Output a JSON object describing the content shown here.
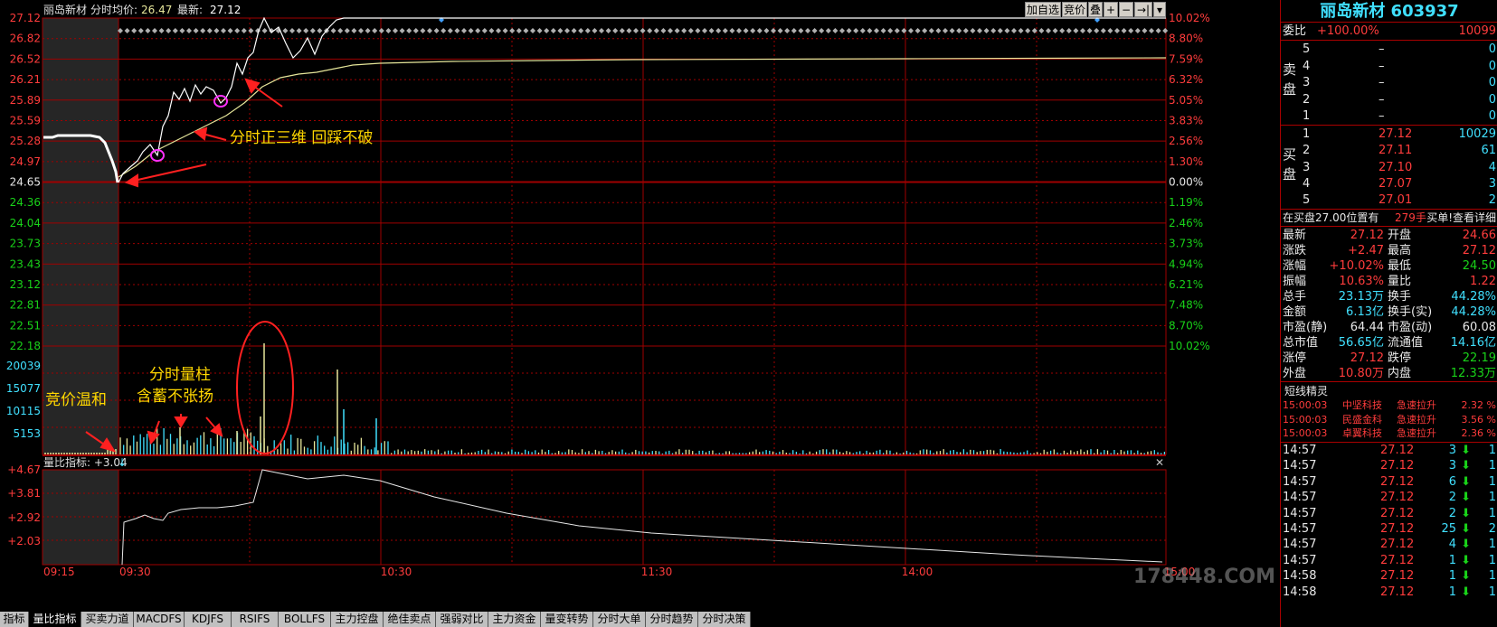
{
  "header": {
    "stock_name": "丽岛新材",
    "mode": "分时",
    "avg_label": "均价:",
    "avg_value": "26.47",
    "latest_label": "最新:",
    "latest_value": "27.12"
  },
  "toolbar": {
    "add_watch": "加自选",
    "auction": "竞价",
    "overlay": "叠",
    "zoom_in": "+",
    "zoom_out": "−",
    "next": "→|",
    "menu": "▾"
  },
  "price_axis_left": [
    "27.12",
    "26.82",
    "26.52",
    "26.21",
    "25.89",
    "25.59",
    "25.28",
    "24.97",
    "24.65",
    "24.36",
    "24.04",
    "23.73",
    "23.43",
    "23.12",
    "22.81",
    "22.51",
    "22.18"
  ],
  "pct_axis_right": [
    "10.02%",
    "8.80%",
    "7.59%",
    "6.32%",
    "5.05%",
    "3.83%",
    "2.56%",
    "1.30%",
    "0.00%",
    "1.19%",
    "2.46%",
    "3.73%",
    "4.94%",
    "6.21%",
    "7.48%",
    "8.70%",
    "10.02%"
  ],
  "volume_axis": [
    "20039",
    "15077",
    "10115",
    "5153"
  ],
  "indicator": {
    "label": "量比指标: +3.04",
    "arrow": "↓",
    "axis": [
      "+4.67",
      "+3.81",
      "+2.92",
      "+2.03"
    ],
    "close": "✕"
  },
  "time_axis": [
    "09:15",
    "09:30",
    "10:30",
    "11:30",
    "14:00",
    "15:00"
  ],
  "annotations": {
    "three_dim": "分时正三维  回踩不破",
    "volume_line1": "分时量柱",
    "volume_line2": "含蓄不张扬",
    "auction_mild": "竞价温和"
  },
  "bottom_tabs": [
    "指标",
    "量比指标",
    "买卖力道",
    "MACDFS",
    "KDJFS",
    "RSIFS",
    "BOLLFS",
    "主力控盘",
    "绝佳卖点",
    "强弱对比",
    "主力资金",
    "量变转势",
    "分时大单",
    "分时趋势",
    "分时决策"
  ],
  "quote": {
    "title": "丽岛新材 603937",
    "weibi_label": "委比",
    "weibi_pct": "+100.00%",
    "weibi_val": "10099",
    "sell_side_label": "卖盘",
    "buy_side_label": "买盘",
    "asks": [
      {
        "lvl": "5",
        "price": "–",
        "vol": "0"
      },
      {
        "lvl": "4",
        "price": "–",
        "vol": "0"
      },
      {
        "lvl": "3",
        "price": "–",
        "vol": "0"
      },
      {
        "lvl": "2",
        "price": "–",
        "vol": "0"
      },
      {
        "lvl": "1",
        "price": "–",
        "vol": "0"
      }
    ],
    "bids": [
      {
        "lvl": "1",
        "price": "27.12",
        "vol": "10029"
      },
      {
        "lvl": "2",
        "price": "27.11",
        "vol": "61"
      },
      {
        "lvl": "3",
        "price": "27.10",
        "vol": "4"
      },
      {
        "lvl": "4",
        "price": "27.07",
        "vol": "3"
      },
      {
        "lvl": "5",
        "price": "27.01",
        "vol": "2"
      }
    ],
    "notice_text": "在买盘27.00位置有",
    "notice_qty": "279手",
    "notice_link": "买单!查看详细",
    "stats": [
      {
        "l1": "最新",
        "v1": "27.12",
        "c1": "red",
        "l2": "开盘",
        "v2": "24.66",
        "c2": "red"
      },
      {
        "l1": "涨跌",
        "v1": "+2.47",
        "c1": "red",
        "l2": "最高",
        "v2": "27.12",
        "c2": "red"
      },
      {
        "l1": "涨幅",
        "v1": "+10.02%",
        "c1": "red",
        "l2": "最低",
        "v2": "24.50",
        "c2": "grn"
      },
      {
        "l1": "振幅",
        "v1": "10.63%",
        "c1": "red",
        "l2": "量比",
        "v2": "1.22",
        "c2": "red"
      },
      {
        "l1": "总手",
        "v1": "23.13万",
        "c1": "cyan",
        "l2": "换手",
        "v2": "44.28%",
        "c2": "cyan"
      },
      {
        "l1": "金额",
        "v1": "6.13亿",
        "c1": "cyan",
        "l2": "换手(实)",
        "v2": "44.28%",
        "c2": "cyan"
      },
      {
        "l1": "市盈(静)",
        "v1": "64.44",
        "c1": "wht",
        "l2": "市盈(动)",
        "v2": "60.08",
        "c2": "wht"
      },
      {
        "l1": "总市值",
        "v1": "56.65亿",
        "c1": "cyan",
        "l2": "流通值",
        "v2": "14.16亿",
        "c2": "cyan"
      },
      {
        "l1": "涨停",
        "v1": "27.12",
        "c1": "red",
        "l2": "跌停",
        "v2": "22.19",
        "c2": "grn"
      },
      {
        "l1": "外盘",
        "v1": "10.80万",
        "c1": "red",
        "l2": "内盘",
        "v2": "12.33万",
        "c2": "grn"
      }
    ],
    "sprite_title": "短线精灵",
    "sprites": [
      {
        "time": "15:00:03",
        "name": "中坚科技",
        "event": "急速拉升",
        "pct": "2.32 %"
      },
      {
        "time": "15:00:03",
        "name": "民盛金科",
        "event": "急速拉升",
        "pct": "3.56 %"
      },
      {
        "time": "15:00:03",
        "name": "卓翼科技",
        "event": "急速拉升",
        "pct": "2.36 %"
      }
    ],
    "ticks": [
      {
        "time": "14:57",
        "price": "27.12",
        "vol": "3",
        "n": "1"
      },
      {
        "time": "14:57",
        "price": "27.12",
        "vol": "3",
        "n": "1"
      },
      {
        "time": "14:57",
        "price": "27.12",
        "vol": "6",
        "n": "1"
      },
      {
        "time": "14:57",
        "price": "27.12",
        "vol": "2",
        "n": "1"
      },
      {
        "time": "14:57",
        "price": "27.12",
        "vol": "2",
        "n": "1"
      },
      {
        "time": "14:57",
        "price": "27.12",
        "vol": "25",
        "n": "2"
      },
      {
        "time": "14:57",
        "price": "27.12",
        "vol": "4",
        "n": "1"
      },
      {
        "time": "14:57",
        "price": "27.12",
        "vol": "1",
        "n": "1"
      },
      {
        "time": "14:58",
        "price": "27.12",
        "vol": "1",
        "n": "1"
      },
      {
        "time": "14:58",
        "price": "27.12",
        "vol": "1",
        "n": "1"
      }
    ]
  },
  "watermark": "178448.COM",
  "colors": {
    "grid": "#a00000",
    "up": "#ff3c3c",
    "down": "#19d219",
    "price_line": "#ffffff",
    "avg_line": "#e6e69a",
    "annotation": "#ffd700"
  }
}
